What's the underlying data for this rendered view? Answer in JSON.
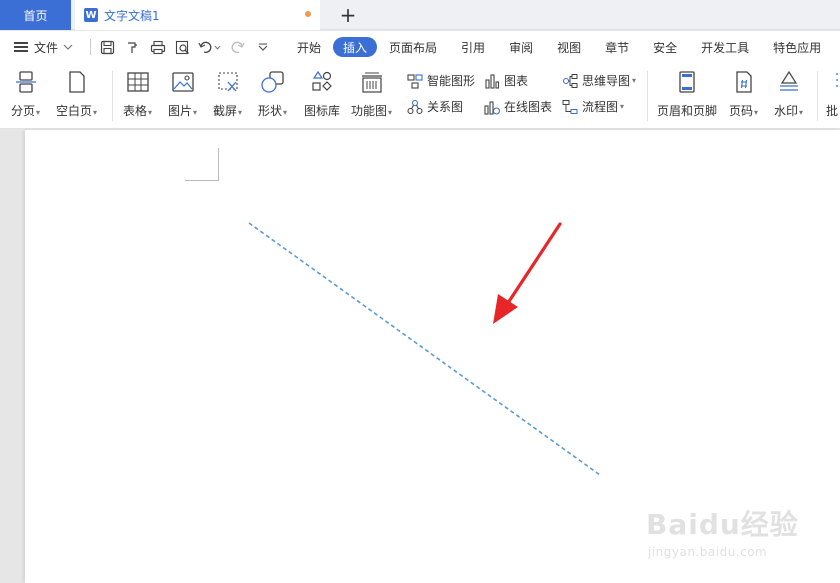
{
  "tabbar": {
    "home_label": "首页",
    "doc_icon_letter": "W",
    "doc_title": "文字文稿1",
    "new_tab_symbol": "+"
  },
  "menu": {
    "file_label": "文件",
    "tabs": [
      "开始",
      "插入",
      "页面布局",
      "引用",
      "审阅",
      "视图",
      "章节",
      "安全",
      "开发工具",
      "特色应用"
    ],
    "active_tab": "插入"
  },
  "ribbon": {
    "page_break": "分页",
    "blank_page": "空白页",
    "table": "表格",
    "picture": "图片",
    "screenshot": "截屏",
    "shapes": "形状",
    "icon_library": "图标库",
    "function_chart": "功能图",
    "smart_graphic": "智能图形",
    "relation_chart": "关系图",
    "chart": "图表",
    "online_chart": "在线图表",
    "mind_map": "思维导图",
    "flowchart": "流程图",
    "header_footer": "页眉和页脚",
    "page_number": "页码",
    "watermark": "水印",
    "batch": "批"
  },
  "colors": {
    "accent": "#3b6fd6",
    "dashed_line": "#5b9bd5",
    "arrow": "#e8262a",
    "unsaved": "#f09a4d"
  },
  "watermark": {
    "brand": "Baidu经验",
    "url": "jingyan.baidu.com"
  }
}
